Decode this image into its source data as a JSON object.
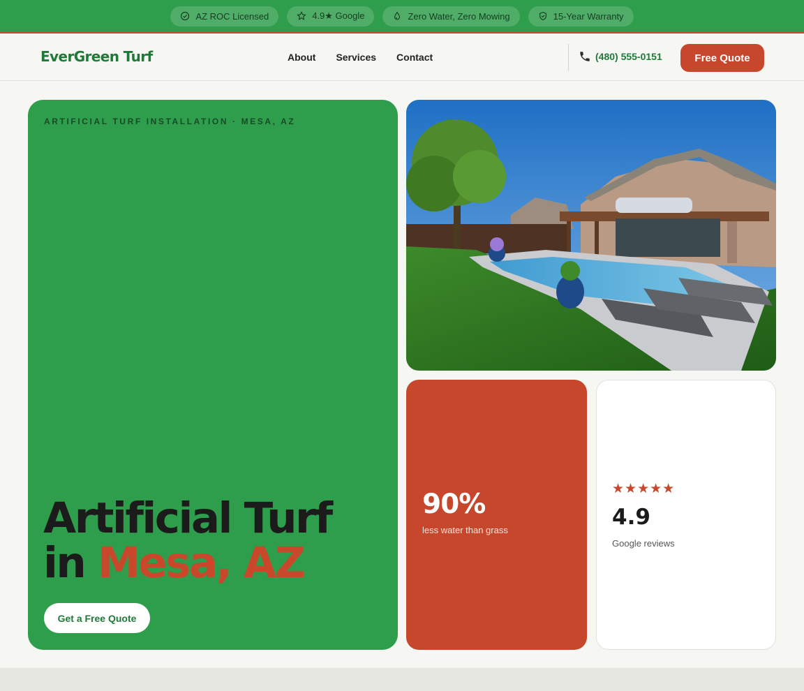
{
  "topbar": {
    "badges": [
      {
        "icon": "check-circle-icon",
        "label": "AZ ROC Licensed"
      },
      {
        "icon": "star-outline-icon",
        "label": "4.9★ Google"
      },
      {
        "icon": "droplet-icon",
        "label": "Zero Water, Zero Mowing"
      },
      {
        "icon": "shield-icon",
        "label": "15-Year Warranty"
      }
    ]
  },
  "header": {
    "logo": "EverGreen Turf",
    "nav": [
      "About",
      "Services",
      "Contact"
    ],
    "phone": "(480) 555-0151",
    "phone_icon": "phone-icon",
    "cta": "Free Quote"
  },
  "hero": {
    "eyebrow": "ARTIFICIAL TURF INSTALLATION · MESA, AZ",
    "headline_line1": "Artificial Turf",
    "headline_line2_prefix": "in ",
    "headline_line2_highlight": "Mesa, AZ",
    "button": "Get a Free Quote"
  },
  "stat": {
    "value": "90%",
    "label": "less water than grass"
  },
  "review": {
    "stars": "★★★★★",
    "rating": "4.9",
    "label": "Google reviews"
  },
  "colors": {
    "brand_green": "#2e9e4c",
    "logo_green": "#1f7a39",
    "accent_red": "#c6472b",
    "page_bg": "#f6f6f3"
  }
}
